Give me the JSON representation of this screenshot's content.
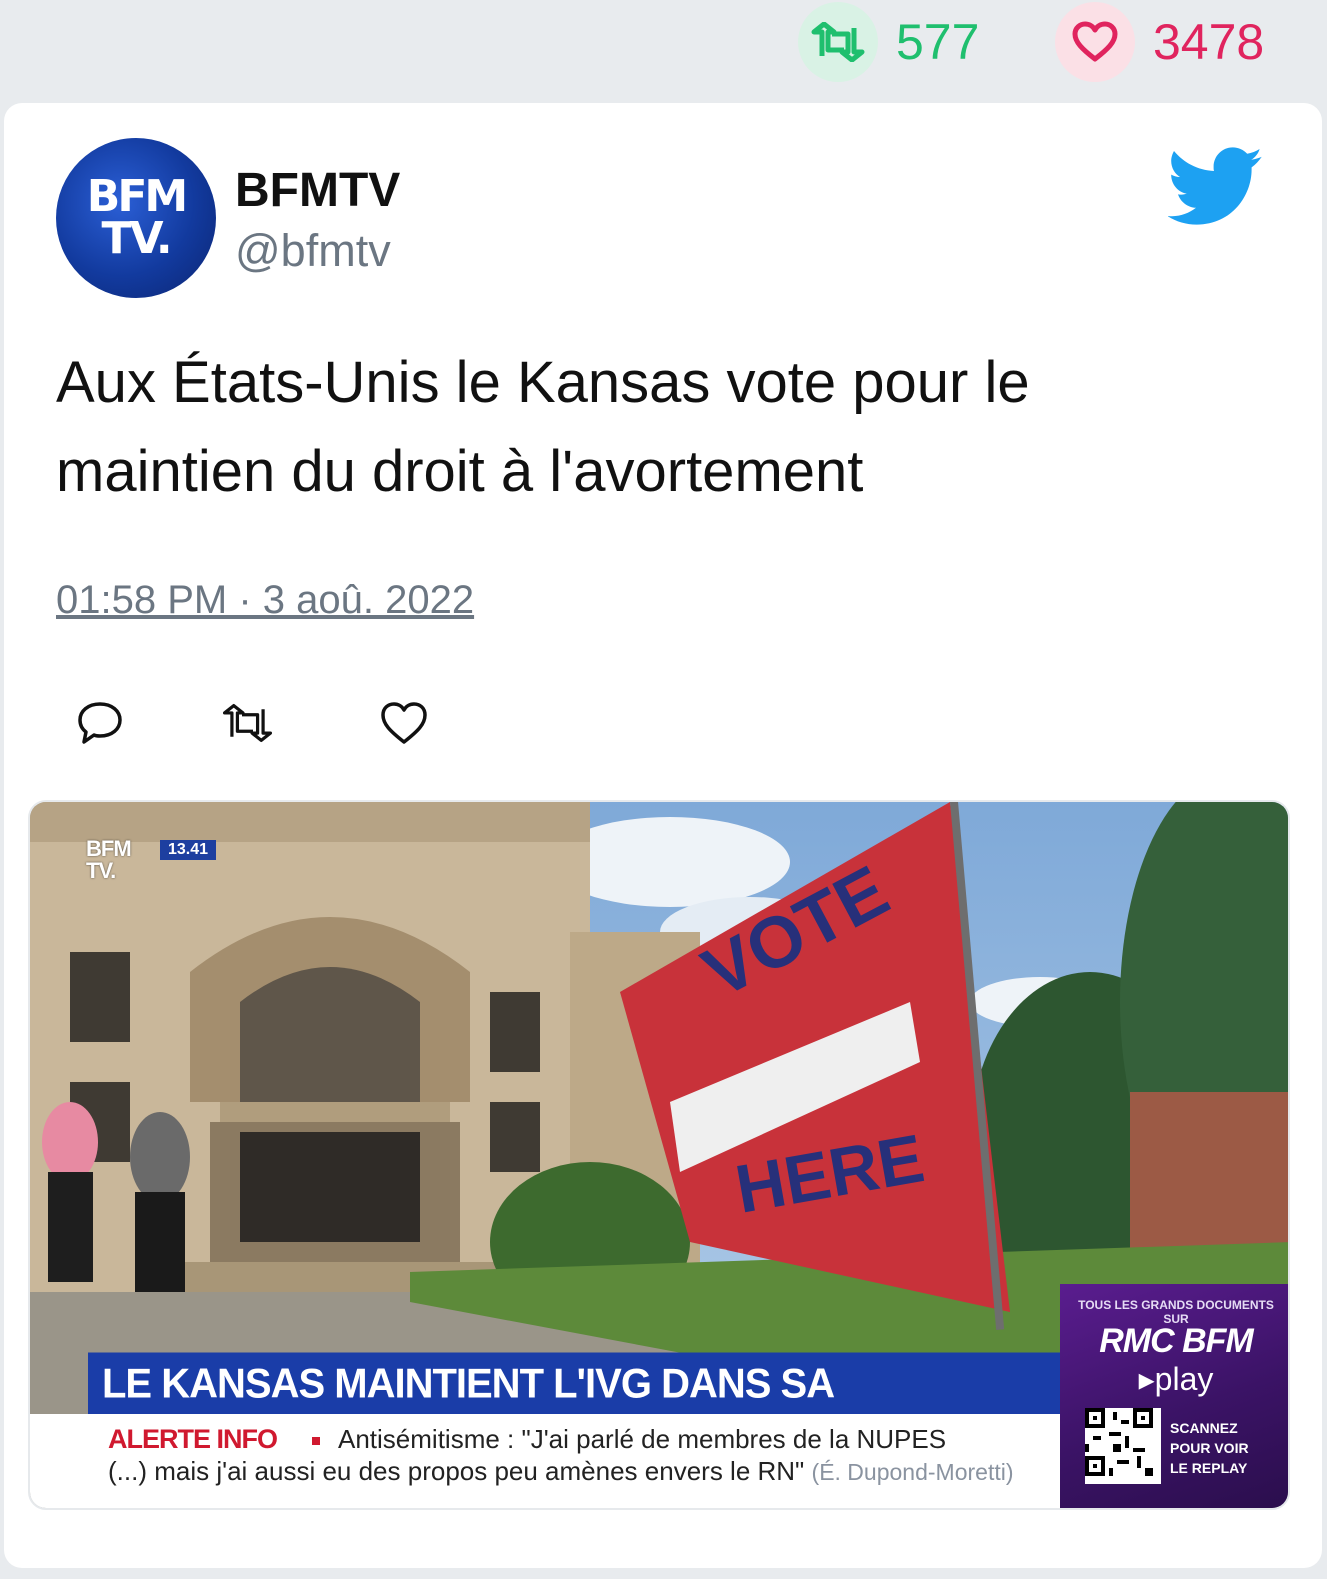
{
  "stats": {
    "retweets": "577",
    "likes": "3478",
    "retweet_color": "#1fbf6e",
    "like_color": "#e0245e"
  },
  "tweet": {
    "author_name": "BFMTV",
    "author_handle": "@bfmtv",
    "avatar_text_line1": "BFM",
    "avatar_text_line2": "TV.",
    "text": "Aux États-Unis le Kansas vote pour le maintien du droit à l'avortement",
    "timestamp": "01:58 PM · 3 aoû. 2022",
    "icons": [
      "twitter-bird-icon",
      "reply-icon",
      "retweet-icon",
      "heart-icon"
    ]
  },
  "media": {
    "channel_logo_line1": "BFM",
    "channel_logo_line2": "TV.",
    "clock": "13.41",
    "sign_line1": "VOTE",
    "sign_line2": "HERE",
    "headline": "LE KANSAS MAINTIENT L'IVG DANS SA CONSTITUTION",
    "alert_label": "ALERTE INFO",
    "alert_line1": "Antisémitisme : \"J'ai parlé de membres de la NUPES",
    "alert_line2": "(...) mais j'ai aussi eu des propos peu amènes envers le RN\"",
    "alert_source": "(É. Dupond-Moretti)",
    "promo_top": "TOUS LES GRANDS DOCUMENTS SUR",
    "promo_brand": "RMC BFM",
    "promo_play": "▸play",
    "promo_scan": "SCANNEZ POUR VOIR LE REPLAY"
  }
}
